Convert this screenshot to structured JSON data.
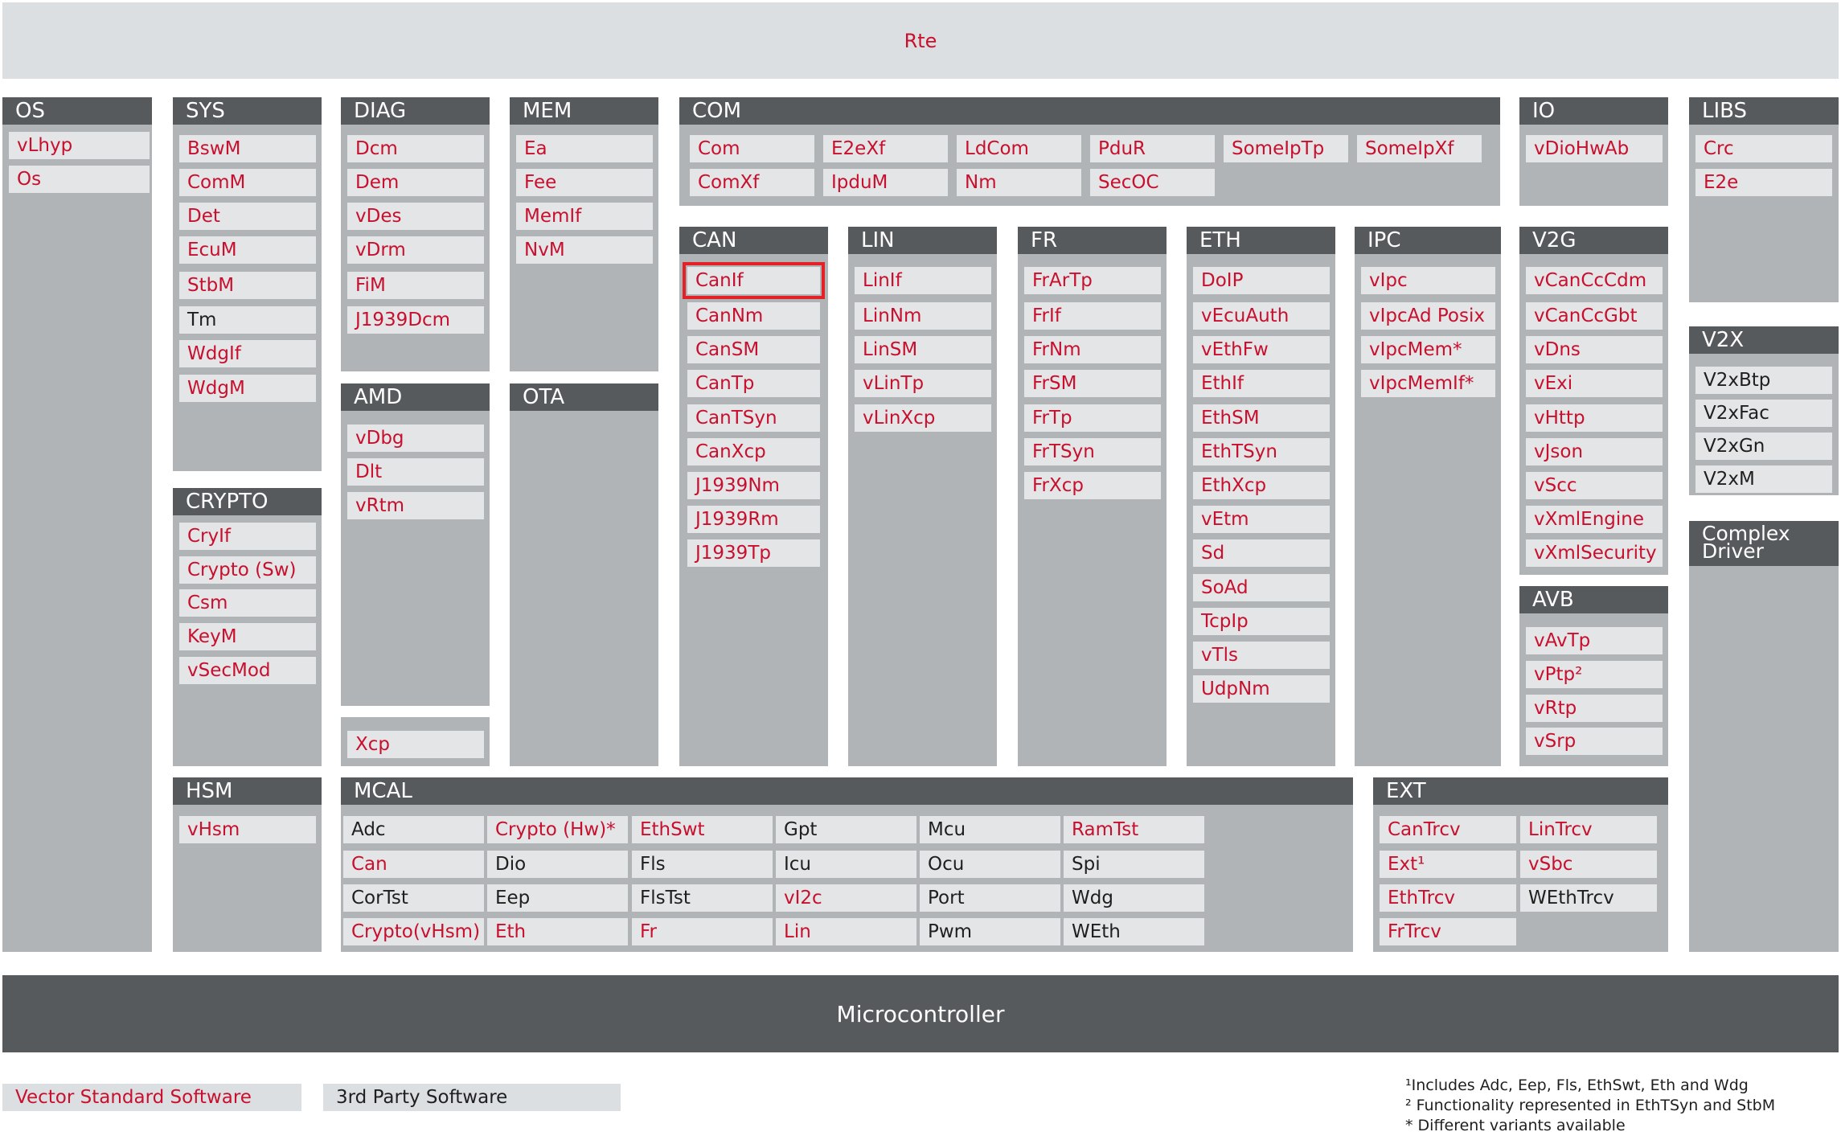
{
  "top_bar": {
    "label": "Rte"
  },
  "bottom_bar": {
    "label": "Microcontroller"
  },
  "colors": {
    "vector": "#c8102e",
    "third": "#1f1f1f",
    "header": "#575a5c",
    "group": "#b1b4b6",
    "module": "#e3e5e7",
    "highlight": "#e32127"
  },
  "groups": [
    {
      "name": "os",
      "title": "OS",
      "modules": [
        {
          "label": "vLhyp",
          "kind": "vector"
        },
        {
          "label": "Os",
          "kind": "vector"
        }
      ]
    },
    {
      "name": "sys",
      "title": "SYS",
      "modules": [
        {
          "label": "BswM",
          "kind": "vector"
        },
        {
          "label": "ComM",
          "kind": "vector"
        },
        {
          "label": "Det",
          "kind": "vector"
        },
        {
          "label": "EcuM",
          "kind": "vector"
        },
        {
          "label": "StbM",
          "kind": "vector"
        },
        {
          "label": "Tm",
          "kind": "third"
        },
        {
          "label": "WdgIf",
          "kind": "vector"
        },
        {
          "label": "WdgM",
          "kind": "vector"
        }
      ]
    },
    {
      "name": "crypto",
      "title": "CRYPTO",
      "modules": [
        {
          "label": "CryIf",
          "kind": "vector"
        },
        {
          "label": "Crypto (Sw)",
          "kind": "vector"
        },
        {
          "label": "Csm",
          "kind": "vector"
        },
        {
          "label": "KeyM",
          "kind": "vector"
        },
        {
          "label": "vSecMod",
          "kind": "vector"
        }
      ]
    },
    {
      "name": "hsm",
      "title": "HSM",
      "modules": [
        {
          "label": "vHsm",
          "kind": "vector"
        }
      ]
    },
    {
      "name": "diag",
      "title": "DIAG",
      "modules": [
        {
          "label": "Dcm",
          "kind": "vector"
        },
        {
          "label": "Dem",
          "kind": "vector"
        },
        {
          "label": "vDes",
          "kind": "vector"
        },
        {
          "label": "vDrm",
          "kind": "vector"
        },
        {
          "label": "FiM",
          "kind": "vector"
        },
        {
          "label": "J1939Dcm",
          "kind": "vector"
        }
      ]
    },
    {
      "name": "amd",
      "title": "AMD",
      "modules": [
        {
          "label": "vDbg",
          "kind": "vector"
        },
        {
          "label": "Dlt",
          "kind": "vector"
        },
        {
          "label": "vRtm",
          "kind": "vector"
        }
      ]
    },
    {
      "name": "xcp",
      "title": "",
      "modules": [
        {
          "label": "Xcp",
          "kind": "vector"
        }
      ]
    },
    {
      "name": "mem",
      "title": "MEM",
      "modules": [
        {
          "label": "Ea",
          "kind": "vector"
        },
        {
          "label": "Fee",
          "kind": "vector"
        },
        {
          "label": "MemIf",
          "kind": "vector"
        },
        {
          "label": "NvM",
          "kind": "vector"
        }
      ]
    },
    {
      "name": "ota",
      "title": "OTA",
      "modules": []
    },
    {
      "name": "com",
      "title": "COM",
      "modules": [
        {
          "label": "Com",
          "kind": "vector"
        },
        {
          "label": "E2eXf",
          "kind": "vector"
        },
        {
          "label": "LdCom",
          "kind": "vector"
        },
        {
          "label": "PduR",
          "kind": "vector"
        },
        {
          "label": "SomeIpTp",
          "kind": "vector"
        },
        {
          "label": "SomeIpXf",
          "kind": "vector"
        },
        {
          "label": "ComXf",
          "kind": "vector"
        },
        {
          "label": "IpduM",
          "kind": "vector"
        },
        {
          "label": "Nm",
          "kind": "vector"
        },
        {
          "label": "SecOC",
          "kind": "vector"
        }
      ]
    },
    {
      "name": "can",
      "title": "CAN",
      "modules": [
        {
          "label": "CanIf",
          "kind": "vector",
          "highlight": true
        },
        {
          "label": "CanNm",
          "kind": "vector"
        },
        {
          "label": "CanSM",
          "kind": "vector"
        },
        {
          "label": "CanTp",
          "kind": "vector"
        },
        {
          "label": "CanTSyn",
          "kind": "vector"
        },
        {
          "label": "CanXcp",
          "kind": "vector"
        },
        {
          "label": "J1939Nm",
          "kind": "vector"
        },
        {
          "label": "J1939Rm",
          "kind": "vector"
        },
        {
          "label": "J1939Tp",
          "kind": "vector"
        }
      ]
    },
    {
      "name": "lin",
      "title": "LIN",
      "modules": [
        {
          "label": "LinIf",
          "kind": "vector"
        },
        {
          "label": "LinNm",
          "kind": "vector"
        },
        {
          "label": "LinSM",
          "kind": "vector"
        },
        {
          "label": "vLinTp",
          "kind": "vector"
        },
        {
          "label": "vLinXcp",
          "kind": "vector"
        }
      ]
    },
    {
      "name": "fr",
      "title": "FR",
      "modules": [
        {
          "label": "FrArTp",
          "kind": "vector"
        },
        {
          "label": "FrIf",
          "kind": "vector"
        },
        {
          "label": "FrNm",
          "kind": "vector"
        },
        {
          "label": "FrSM",
          "kind": "vector"
        },
        {
          "label": "FrTp",
          "kind": "vector"
        },
        {
          "label": "FrTSyn",
          "kind": "vector"
        },
        {
          "label": "FrXcp",
          "kind": "vector"
        }
      ]
    },
    {
      "name": "eth",
      "title": "ETH",
      "modules": [
        {
          "label": "DoIP",
          "kind": "vector"
        },
        {
          "label": "vEcuAuth",
          "kind": "vector"
        },
        {
          "label": "vEthFw",
          "kind": "vector"
        },
        {
          "label": "EthIf",
          "kind": "vector"
        },
        {
          "label": "EthSM",
          "kind": "vector"
        },
        {
          "label": "EthTSyn",
          "kind": "vector"
        },
        {
          "label": "EthXcp",
          "kind": "vector"
        },
        {
          "label": "vEtm",
          "kind": "vector"
        },
        {
          "label": "Sd",
          "kind": "vector"
        },
        {
          "label": "SoAd",
          "kind": "vector"
        },
        {
          "label": "TcpIp",
          "kind": "vector"
        },
        {
          "label": "vTls",
          "kind": "vector"
        },
        {
          "label": "UdpNm",
          "kind": "vector"
        }
      ]
    },
    {
      "name": "ipc",
      "title": "IPC",
      "modules": [
        {
          "label": "vIpc",
          "kind": "vector"
        },
        {
          "label": "vIpcAd Posix",
          "kind": "vector"
        },
        {
          "label": "vIpcMem*",
          "kind": "vector"
        },
        {
          "label": "vIpcMemIf*",
          "kind": "vector"
        }
      ]
    },
    {
      "name": "io",
      "title": "IO",
      "modules": [
        {
          "label": "vDioHwAb",
          "kind": "vector"
        }
      ]
    },
    {
      "name": "v2g",
      "title": "V2G",
      "modules": [
        {
          "label": "vCanCcCdm",
          "kind": "vector"
        },
        {
          "label": "vCanCcGbt",
          "kind": "vector"
        },
        {
          "label": "vDns",
          "kind": "vector"
        },
        {
          "label": "vExi",
          "kind": "vector"
        },
        {
          "label": "vHttp",
          "kind": "vector"
        },
        {
          "label": "vJson",
          "kind": "vector"
        },
        {
          "label": "vScc",
          "kind": "vector"
        },
        {
          "label": "vXmlEngine",
          "kind": "vector"
        },
        {
          "label": "vXmlSecurity",
          "kind": "vector"
        }
      ]
    },
    {
      "name": "avb",
      "title": "AVB",
      "modules": [
        {
          "label": "vAvTp",
          "kind": "vector"
        },
        {
          "label": "vPtp²",
          "kind": "vector"
        },
        {
          "label": "vRtp",
          "kind": "vector"
        },
        {
          "label": "vSrp",
          "kind": "vector"
        }
      ]
    },
    {
      "name": "libs",
      "title": "LIBS",
      "modules": [
        {
          "label": "Crc",
          "kind": "vector"
        },
        {
          "label": "E2e",
          "kind": "vector"
        }
      ]
    },
    {
      "name": "v2x",
      "title": "V2X",
      "modules": [
        {
          "label": "V2xBtp",
          "kind": "third"
        },
        {
          "label": "V2xFac",
          "kind": "third"
        },
        {
          "label": "V2xGn",
          "kind": "third"
        },
        {
          "label": "V2xM",
          "kind": "third"
        }
      ]
    },
    {
      "name": "complex-driver",
      "title": "Complex Driver",
      "modules": []
    },
    {
      "name": "mcal",
      "title": "MCAL",
      "modules": [
        {
          "label": "Adc",
          "kind": "third"
        },
        {
          "label": "Crypto (Hw)*",
          "kind": "vector"
        },
        {
          "label": "EthSwt",
          "kind": "vector"
        },
        {
          "label": "Gpt",
          "kind": "third"
        },
        {
          "label": "Mcu",
          "kind": "third"
        },
        {
          "label": "RamTst",
          "kind": "vector"
        },
        {
          "label": "Can",
          "kind": "vector"
        },
        {
          "label": "Dio",
          "kind": "third"
        },
        {
          "label": "Fls",
          "kind": "third"
        },
        {
          "label": "Icu",
          "kind": "third"
        },
        {
          "label": "Ocu",
          "kind": "third"
        },
        {
          "label": "Spi",
          "kind": "third"
        },
        {
          "label": "CorTst",
          "kind": "third"
        },
        {
          "label": "Eep",
          "kind": "third"
        },
        {
          "label": "FlsTst",
          "kind": "third"
        },
        {
          "label": "vI2c",
          "kind": "vector"
        },
        {
          "label": "Port",
          "kind": "third"
        },
        {
          "label": "Wdg",
          "kind": "third"
        },
        {
          "label": "Crypto(vHsm)",
          "kind": "vector"
        },
        {
          "label": "Eth",
          "kind": "vector"
        },
        {
          "label": "Fr",
          "kind": "vector"
        },
        {
          "label": "Lin",
          "kind": "vector"
        },
        {
          "label": "Pwm",
          "kind": "third"
        },
        {
          "label": "WEth",
          "kind": "third"
        }
      ]
    },
    {
      "name": "ext",
      "title": "EXT",
      "modules": [
        {
          "label": "CanTrcv",
          "kind": "vector"
        },
        {
          "label": "LinTrcv",
          "kind": "vector"
        },
        {
          "label": "Ext¹",
          "kind": "vector"
        },
        {
          "label": "vSbc",
          "kind": "vector"
        },
        {
          "label": "EthTrcv",
          "kind": "vector"
        },
        {
          "label": "WEthTrcv",
          "kind": "third"
        },
        {
          "label": "FrTrcv",
          "kind": "vector"
        }
      ]
    }
  ],
  "legend": [
    {
      "label": "Vector Standard Software",
      "kind": "vector"
    },
    {
      "label": "3rd Party Software",
      "kind": "third"
    }
  ],
  "footnotes": [
    "¹Includes Adc, Eep, Fls, EthSwt, Eth and Wdg",
    "² Functionality represented in EthTSyn and StbM",
    "* Different variants available"
  ]
}
